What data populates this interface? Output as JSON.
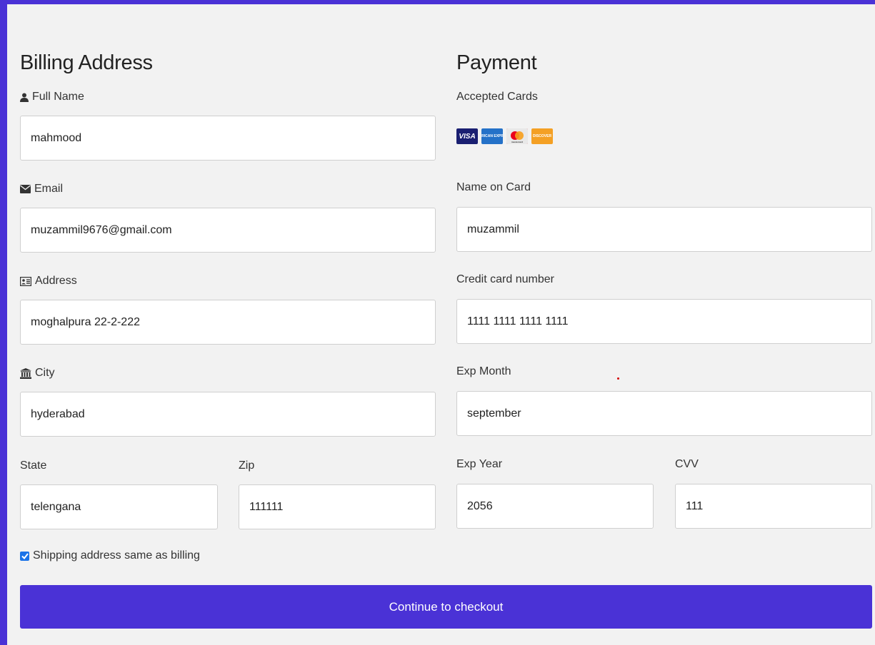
{
  "billing": {
    "heading": "Billing Address",
    "full_name_label": "Full Name",
    "full_name_value": "mahmood",
    "email_label": "Email",
    "email_value": "muzammil9676@gmail.com",
    "address_label": "Address",
    "address_value": "moghalpura 22-2-222",
    "city_label": "City",
    "city_value": "hyderabad",
    "state_label": "State",
    "state_value": "telengana",
    "zip_label": "Zip",
    "zip_value": "111111"
  },
  "payment": {
    "heading": "Payment",
    "accepted_cards_label": "Accepted Cards",
    "cards": [
      "VISA",
      "AMERICAN EXPRESS",
      "mastercard",
      "DISCOVER"
    ],
    "name_on_card_label": "Name on Card",
    "name_on_card_value": "muzammil",
    "card_number_label": "Credit card number",
    "card_number_value": "1111 1111 1111 1111",
    "exp_month_label": "Exp Month",
    "exp_month_value": "september",
    "exp_year_label": "Exp Year",
    "exp_year_value": "2056",
    "cvv_label": "CVV",
    "cvv_value": "111"
  },
  "shipping_same": {
    "label": "Shipping address same as billing",
    "checked": true
  },
  "checkout_button": "Continue to checkout",
  "colors": {
    "accent": "#4a32d6",
    "panel_bg": "#f2f2f2",
    "checkbox": "#1a73e8"
  },
  "icons": [
    "user-icon",
    "envelope-icon",
    "address-card-icon",
    "institution-icon",
    "check-icon"
  ]
}
